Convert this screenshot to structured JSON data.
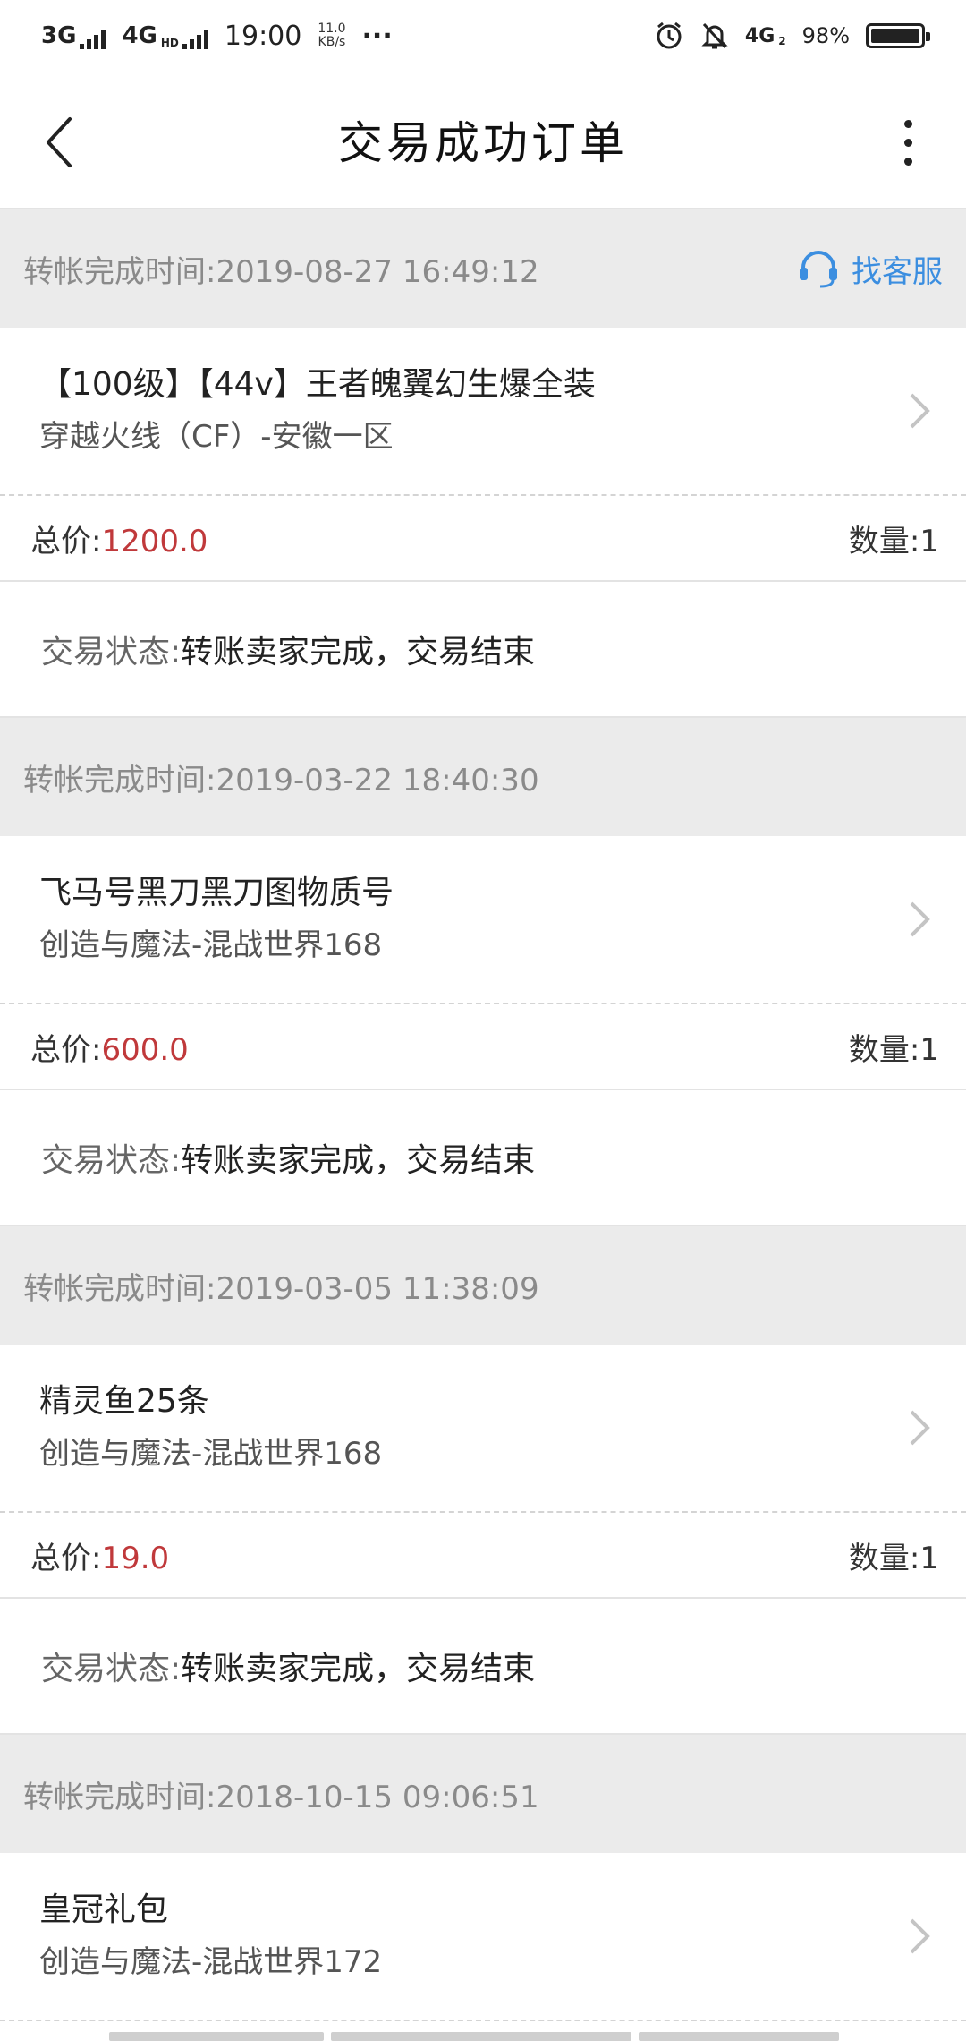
{
  "status_bar": {
    "net1": "3G",
    "net2": "4G",
    "net2_sup": "HD",
    "time": "19:00",
    "speed_val": "11.0",
    "speed_unit": "KB/s",
    "more": "···",
    "net3": "4G",
    "net3_sub": "2",
    "battery": "98%"
  },
  "header": {
    "title": "交易成功订单"
  },
  "service_label": "找客服",
  "orders": [
    {
      "time_label": "转帐完成时间:",
      "time": "2019-08-27 16:49:12",
      "name": "【100级】【44v】王者魄翼幻生爆全装",
      "server": "穿越火线（CF）-安徽一区",
      "price_label": "总价:",
      "price": "1200.0",
      "qty_label": "数量:",
      "qty": "1",
      "status_label": "交易状态:",
      "status": "转账卖家完成，交易结束"
    },
    {
      "time_label": "转帐完成时间:",
      "time": "2019-03-22 18:40:30",
      "name": "飞马号黑刀黑刀图物质号",
      "server": "创造与魔法-混战世界168",
      "price_label": "总价:",
      "price": "600.0",
      "qty_label": "数量:",
      "qty": "1",
      "status_label": "交易状态:",
      "status": "转账卖家完成，交易结束"
    },
    {
      "time_label": "转帐完成时间:",
      "time": "2019-03-05 11:38:09",
      "name": "精灵鱼25条",
      "server": "创造与魔法-混战世界168",
      "price_label": "总价:",
      "price": "19.0",
      "qty_label": "数量:",
      "qty": "1",
      "status_label": "交易状态:",
      "status": "转账卖家完成，交易结束"
    },
    {
      "time_label": "转帐完成时间:",
      "time": "2018-10-15 09:06:51",
      "name": "皇冠礼包",
      "server": "创造与魔法-混战世界172"
    }
  ]
}
